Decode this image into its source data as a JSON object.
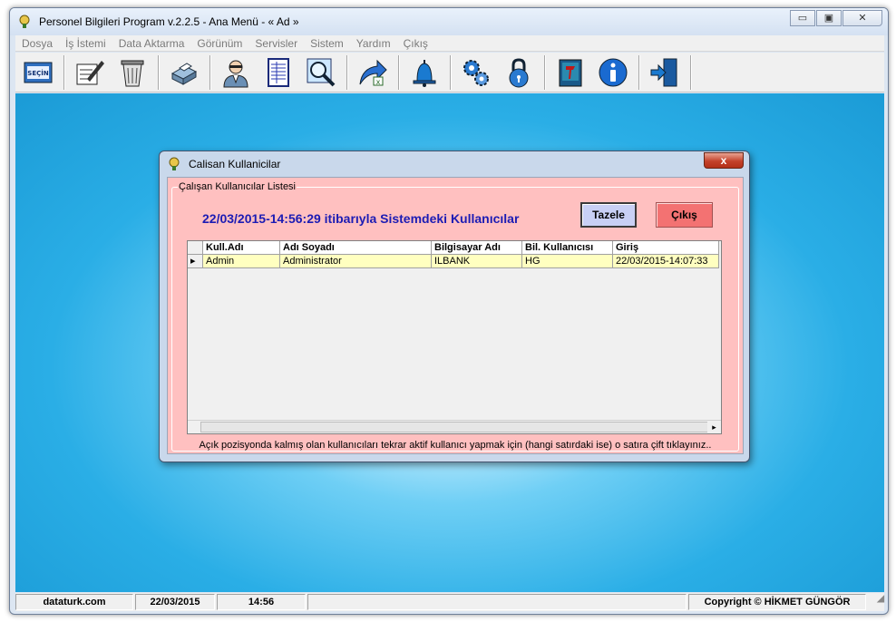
{
  "window": {
    "title": "Personel Bilgileri Program v.2.2.5  - Ana Menü -  « Ad »",
    "minimize": "▭",
    "maximize": "▣",
    "close": "✕"
  },
  "menu": [
    "Dosya",
    "İş İstemi",
    "Data Aktarma",
    "Görünüm",
    "Servisler",
    "Sistem",
    "Yardım",
    "Çıkış"
  ],
  "toolbar": {
    "icons": [
      "secim-icon",
      "edit-form-icon",
      "recycle-bin-icon",
      "printer-icon",
      "user-icon",
      "document-list-icon",
      "search-icon",
      "export-icon",
      "bell-icon",
      "settings-gears-icon",
      "lock-icon",
      "book-icon",
      "info-icon",
      "exit-door-icon"
    ],
    "secim_label": "SEÇİN"
  },
  "status": {
    "site": "dataturk.com",
    "date": "22/03/2015",
    "time": "14:56",
    "copyright": "Copyright © HİKMET GÜNGÖR"
  },
  "dialog": {
    "title": "Calisan Kullanicilar",
    "close": "x",
    "group_label": "Çalışan Kullanıcılar Listesi",
    "headline": "22/03/2015-14:56:29 itibarıyla Sistemdeki Kullanıcılar",
    "refresh_button": "Tazele",
    "exit_button": "Çıkış",
    "columns": [
      "Kull.Adı",
      "Adı Soyadı",
      "Bilgisayar Adı",
      "Bil. Kullanıcısı",
      "Giriş"
    ],
    "rows": [
      [
        "Admin",
        "Administrator",
        "ILBANK",
        "HG",
        "22/03/2015-14:07:33"
      ]
    ],
    "row_indicator": "▸",
    "scroll_right": "▸",
    "footer_note": "Açık pozisyonda kalmış olan kullanıcıları tekrar aktif kullanıcı yapmak için (hangi satırdaki ise)  o satıra çift tıklayınız.."
  },
  "colors": {
    "dialog_body": "#ffc0c0",
    "headline": "#1c1cb4",
    "exit_button": "#f37272",
    "refresh_button": "#c8d0f5",
    "data_row": "#ffffc0",
    "workspace": "#2aaee6"
  }
}
